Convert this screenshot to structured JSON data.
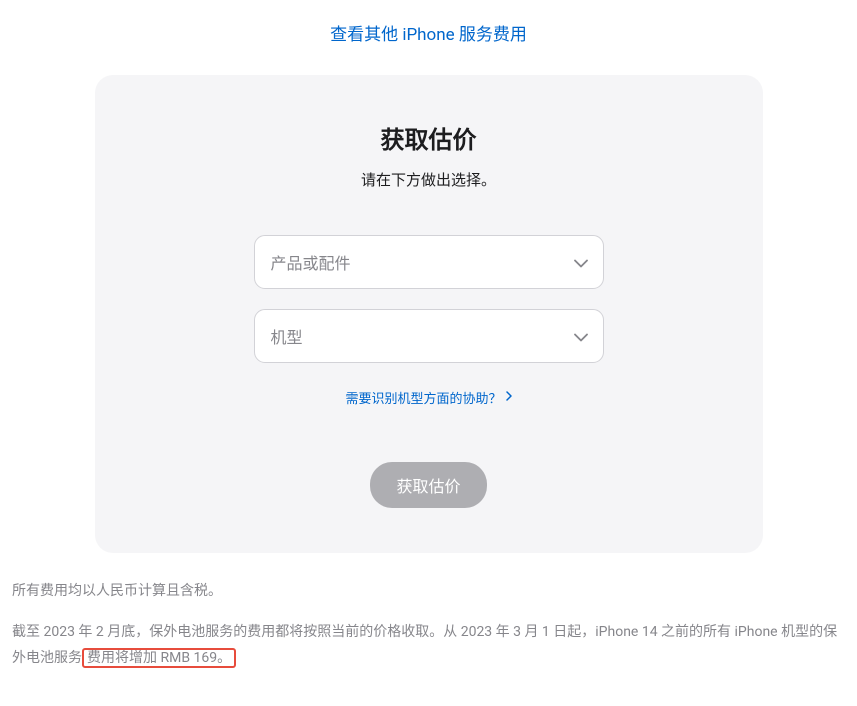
{
  "topLink": {
    "label": "查看其他 iPhone 服务费用"
  },
  "card": {
    "title": "获取估价",
    "subtitle": "请在下方做出选择。",
    "select1": {
      "placeholder": "产品或配件"
    },
    "select2": {
      "placeholder": "机型"
    },
    "helpLink": "需要识别机型方面的协助？",
    "submitLabel": "获取估价"
  },
  "disclaimer": {
    "line1": "所有费用均以人民币计算且含税。",
    "line2_prefix": "截至 2023 年 2 月底，保外电池服务的费用都将按照当前的价格收取。从 2023 年 3 月 1 日起，iPhone 14 之前的所有 iPhone 机型的保外电池服务",
    "line2_highlight": "费用将增加 RMB 169。"
  }
}
